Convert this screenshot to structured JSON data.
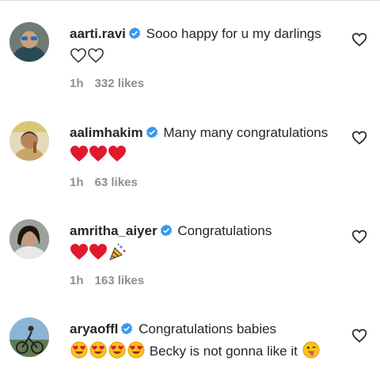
{
  "comments": [
    {
      "username": "aarti.ravi",
      "text": "Sooo happy for u my darlings",
      "emoji": [
        "white-heart",
        "white-heart"
      ],
      "time": "1h",
      "likes": "332 likes"
    },
    {
      "username": "aalimhakim",
      "text": "Many many congratulations",
      "emoji": [
        "red-heart",
        "red-heart",
        "red-heart"
      ],
      "time": "1h",
      "likes": "63 likes"
    },
    {
      "username": "amritha_aiyer",
      "text": "Congratulations",
      "emoji": [
        "red-heart",
        "red-heart",
        "party-popper"
      ],
      "time": "1h",
      "likes": "163 likes"
    },
    {
      "username": "aryaoffl",
      "text": "Congratulations babies",
      "emoji": [
        "heart-eyes",
        "heart-eyes",
        "heart-eyes",
        "heart-eyes"
      ],
      "text2": "Becky is not gonna like it",
      "emoji2": [
        "winking-tongue"
      ]
    }
  ],
  "colors": {
    "verified": "#3897f0",
    "heart_red": "#e0192d",
    "meta": "#8e8e8e"
  }
}
